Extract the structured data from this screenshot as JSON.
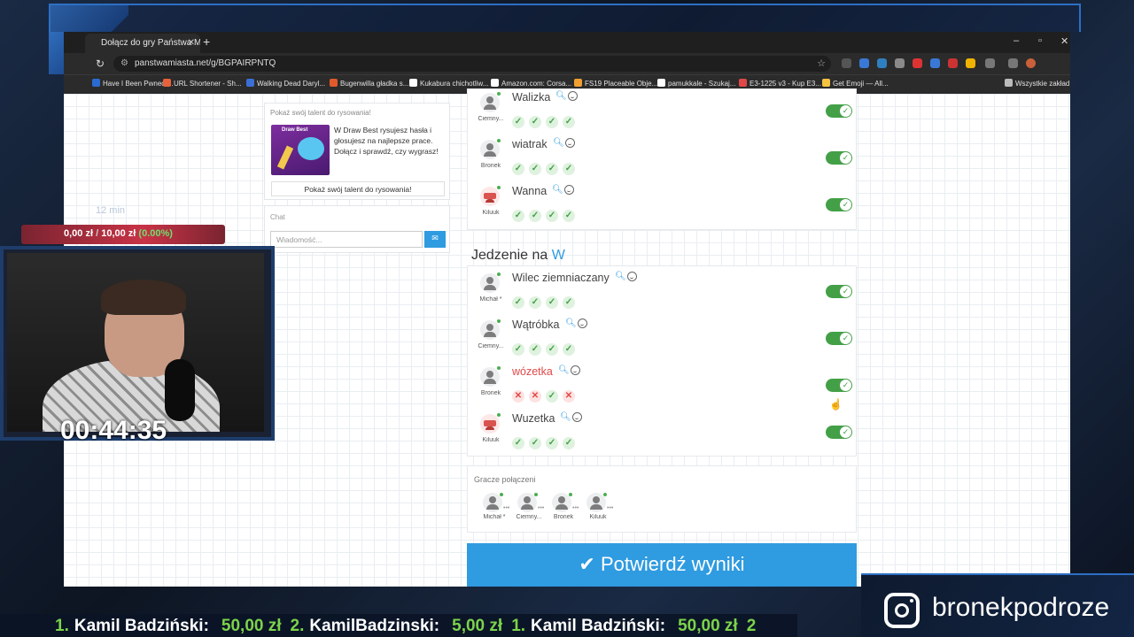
{
  "browser": {
    "tab_title": "Dołącz do gry Państwa Miasta",
    "url": "panstwamiasta.net/g/BGPAIRPNTQ",
    "bookmarks": [
      {
        "label": "Have I Been Pwned:...",
        "color": "#2a6bd1"
      },
      {
        "label": "URL Shortener - Sh...",
        "color": "#e8613a"
      },
      {
        "label": "Walking Dead Daryl...",
        "color": "#3b6fd6"
      },
      {
        "label": "Bugenwilla gładka s...",
        "color": "#e25a2b"
      },
      {
        "label": "Kukabura chichotliw...",
        "color": "#ffffff"
      },
      {
        "label": "Amazon.com: Corsa...",
        "color": "#ffffff"
      },
      {
        "label": "FS19 Placeable Obje...",
        "color": "#f0a030"
      },
      {
        "label": "pamukkale - Szukaj...",
        "color": "#ffffff"
      },
      {
        "label": "E3-1225 v3 - Kup E3...",
        "color": "#e04848"
      },
      {
        "label": "Get Emoji — All...",
        "color": "#f5c242"
      },
      {
        "label": "Wszystkie zakład",
        "color": "#bbbbbb"
      }
    ]
  },
  "ad": {
    "title": "Pokaż swój talent do rysowania!",
    "image_label": "Draw Best",
    "text": "W Draw Best rysujesz hasła i głosujesz na najlepsze prace. Dołącz i sprawdź, czy wygrasz!",
    "button": "Pokaż swój talent do rysowania!"
  },
  "chat": {
    "title": "Chat",
    "placeholder": "Wiadomość..."
  },
  "section1": {
    "rows": [
      {
        "player": "Ciemny...",
        "word": "Walizka",
        "marks": [
          "ok",
          "ok",
          "ok",
          "ok"
        ],
        "special": false
      },
      {
        "player": "Bronek",
        "word": "wiatrak",
        "marks": [
          "ok",
          "ok",
          "ok",
          "ok"
        ],
        "special": false
      },
      {
        "player": "Kiluuk",
        "word": "Wanna",
        "marks": [
          "ok",
          "ok",
          "ok",
          "ok"
        ],
        "special": true
      }
    ]
  },
  "category": {
    "title": "Jedzenie na",
    "letter": "W"
  },
  "section2": {
    "rows": [
      {
        "player": "Michał *",
        "word": "Wilec ziemniaczany",
        "marks": [
          "ok",
          "ok",
          "ok",
          "ok"
        ],
        "special": false
      },
      {
        "player": "Ciemny...",
        "word": "Wątróbka",
        "marks": [
          "ok",
          "ok",
          "ok",
          "ok"
        ],
        "special": false
      },
      {
        "player": "Bronek",
        "word": "wózetka",
        "marks": [
          "no",
          "no",
          "ok",
          "no"
        ],
        "special": false,
        "bad": true
      },
      {
        "player": "Kiluuk",
        "word": "Wuzetka",
        "marks": [
          "ok",
          "ok",
          "ok",
          "ok"
        ],
        "special": true
      }
    ]
  },
  "players": {
    "title": "Gracze połączeni",
    "list": [
      "Michał *",
      "Ciemny...",
      "Bronek",
      "Kiluuk"
    ]
  },
  "confirm_button": "Potwierdź wyniki",
  "overlay": {
    "timer_label": "12 min",
    "money_current": "0,00 zł",
    "money_sep": "/",
    "money_goal": "10,00 zł",
    "money_pct": "(0.00%)",
    "clock": "00:44:35",
    "instagram": "bronekpodroze",
    "ticker": [
      {
        "rank": "1.",
        "name": "Kamil Badziński:",
        "amount": "50,00 zł"
      },
      {
        "rank": "2.",
        "name": "KamilBadzinski:",
        "amount": "5,00 zł"
      },
      {
        "rank": "1.",
        "name": "Kamil Badziński:",
        "amount": "50,00 zł"
      },
      {
        "rank": "2",
        "name": "",
        "amount": ""
      }
    ]
  }
}
